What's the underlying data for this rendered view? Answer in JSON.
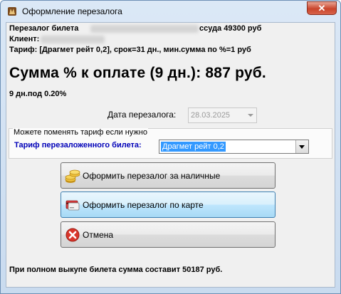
{
  "window": {
    "title": "Оформление перезалога",
    "close_label": "✕"
  },
  "info": {
    "ticket_label": "Перезалог билета",
    "loan_text": "ссуда 49300 руб",
    "client_label": "Клиент:",
    "tariff_line": "Тариф: [Драгмет рейт 0,2], срок=31 дн., мин.сумма по %=1 руб"
  },
  "summary": {
    "amount_line": "Сумма % к оплате (9 дн.): 887 руб.",
    "rate_line": "9 дн.под 0.20%"
  },
  "date": {
    "label": "Дата перезалога:",
    "value": "28.03.2025"
  },
  "tariff_group": {
    "legend": "Можете поменять тариф если нужно",
    "label": "Тариф перезаложенного билета:",
    "selected": "Драгмет рейт 0,2"
  },
  "actions": {
    "cash_label": "Оформить перезалог за наличные",
    "card_label": "Оформить перезалог по карте",
    "cancel_label": "Отмена"
  },
  "footer": {
    "buyout_text": "При полном выкупе билета сумма составит 50187 руб."
  }
}
